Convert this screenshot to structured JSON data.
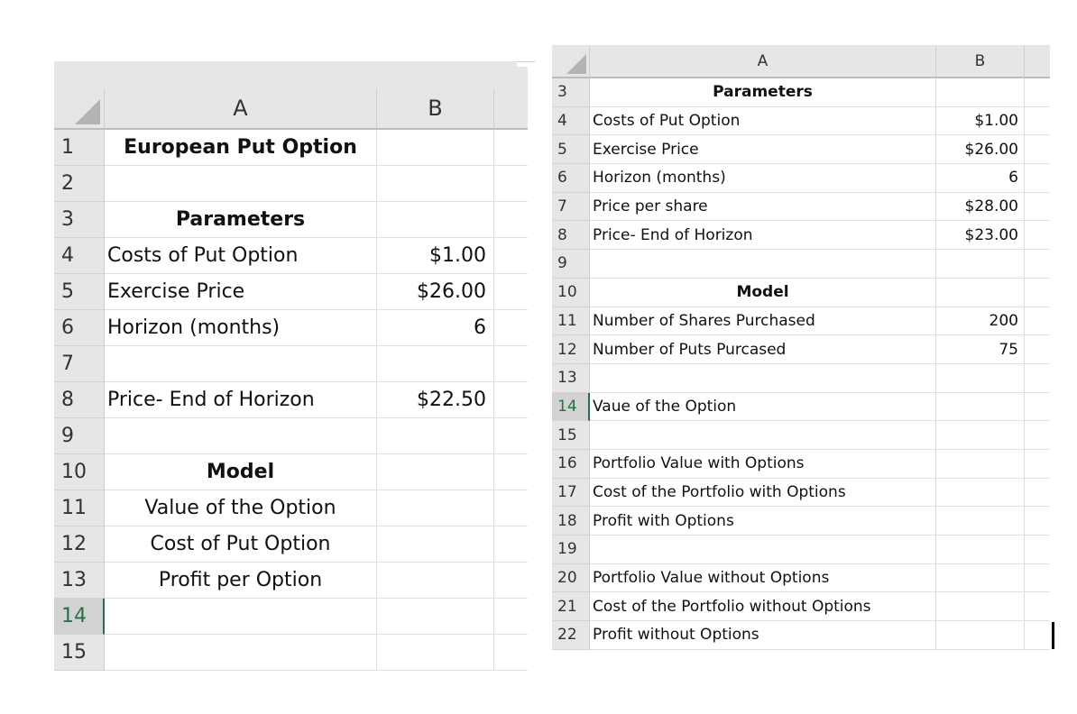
{
  "left_sheet": {
    "columns": [
      "A",
      "B"
    ],
    "active_row": "14",
    "rows": [
      {
        "num": "1",
        "a": "European Put Option",
        "b": "",
        "a_style": "bold-center"
      },
      {
        "num": "2",
        "a": "",
        "b": ""
      },
      {
        "num": "3",
        "a": "Parameters",
        "b": "",
        "a_style": "bold-center"
      },
      {
        "num": "4",
        "a": "Costs of Put Option",
        "b": "$1.00"
      },
      {
        "num": "5",
        "a": "Exercise Price",
        "b": "$26.00"
      },
      {
        "num": "6",
        "a": "Horizon (months)",
        "b": "6"
      },
      {
        "num": "7",
        "a": "",
        "b": ""
      },
      {
        "num": "8",
        "a": "Price- End of Horizon",
        "b": "$22.50"
      },
      {
        "num": "9",
        "a": "",
        "b": ""
      },
      {
        "num": "10",
        "a": "Model",
        "b": "",
        "a_style": "bold-center"
      },
      {
        "num": "11",
        "a": "Value of the Option",
        "b": "",
        "a_style": "center"
      },
      {
        "num": "12",
        "a": "Cost of Put Option",
        "b": "",
        "a_style": "center"
      },
      {
        "num": "13",
        "a": "Profit per Option",
        "b": "",
        "a_style": "center"
      },
      {
        "num": "14",
        "a": "",
        "b": ""
      },
      {
        "num": "15",
        "a": "",
        "b": ""
      }
    ]
  },
  "right_sheet": {
    "columns": [
      "A",
      "B"
    ],
    "active_row": "14",
    "rows": [
      {
        "num": "3",
        "a": "Parameters",
        "b": "",
        "a_style": "bold-center"
      },
      {
        "num": "4",
        "a": "Costs of Put Option",
        "b": "$1.00"
      },
      {
        "num": "5",
        "a": "Exercise Price",
        "b": "$26.00"
      },
      {
        "num": "6",
        "a": "Horizon (months)",
        "b": "6"
      },
      {
        "num": "7",
        "a": "Price per share",
        "b": "$28.00"
      },
      {
        "num": "8",
        "a": "Price- End of Horizon",
        "b": "$23.00"
      },
      {
        "num": "9",
        "a": "",
        "b": ""
      },
      {
        "num": "10",
        "a": "Model",
        "b": "",
        "a_style": "bold-center"
      },
      {
        "num": "11",
        "a": "Number of Shares Purchased",
        "b": "200"
      },
      {
        "num": "12",
        "a": "Number of Puts Purcased",
        "b": "75"
      },
      {
        "num": "13",
        "a": "",
        "b": ""
      },
      {
        "num": "14",
        "a": "Vaue of the Option",
        "b": ""
      },
      {
        "num": "15",
        "a": "",
        "b": ""
      },
      {
        "num": "16",
        "a": "Portfolio Value with Options",
        "b": ""
      },
      {
        "num": "17",
        "a": "Cost of the Portfolio with Options",
        "b": ""
      },
      {
        "num": "18",
        "a": "Profit with Options",
        "b": ""
      },
      {
        "num": "19",
        "a": "",
        "b": ""
      },
      {
        "num": "20",
        "a": "Portfolio Value without Options",
        "b": ""
      },
      {
        "num": "21",
        "a": "Cost of the Portfolio without Options",
        "b": ""
      },
      {
        "num": "22",
        "a": "Profit without Options",
        "b": ""
      }
    ]
  },
  "colors": {
    "header_bg": "#e6e6e6",
    "active_accent": "#217346",
    "gridline": "#e0e0e0"
  }
}
